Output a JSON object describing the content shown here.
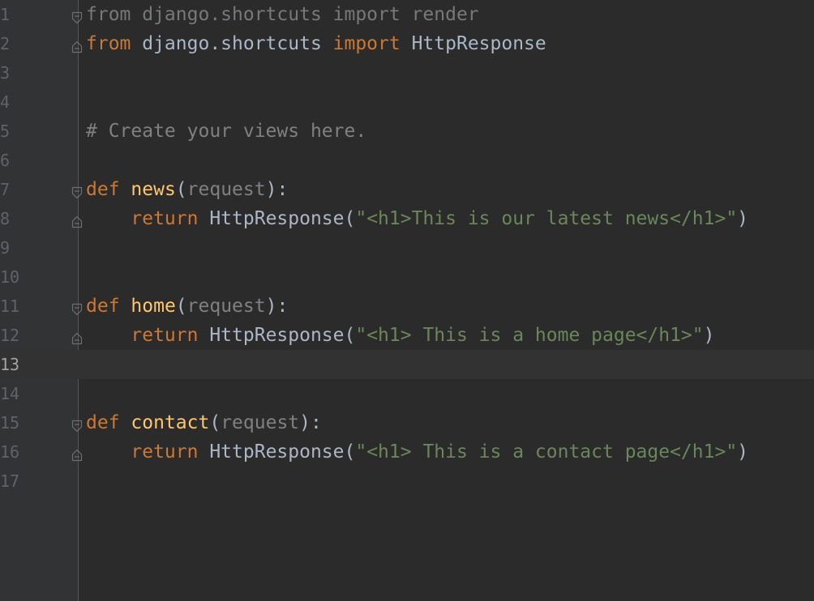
{
  "editor": {
    "theme": {
      "background": "#2b2b2b",
      "gutter": "#313335",
      "keyword": "#cc7832",
      "function": "#ffc66d",
      "string": "#6a8759",
      "identifier": "#a9b7c6",
      "comment": "#808080"
    },
    "current_line": 13,
    "lines": [
      {
        "n": "1",
        "fold": "open",
        "tokens": [
          {
            "t": "dim",
            "v": "from django.shortcuts import render"
          }
        ]
      },
      {
        "n": "2",
        "fold": "close",
        "tokens": [
          {
            "t": "kw",
            "v": "from"
          },
          {
            "t": "txt",
            "v": " django.shortcuts "
          },
          {
            "t": "kw",
            "v": "import"
          },
          {
            "t": "txt",
            "v": " HttpResponse"
          }
        ]
      },
      {
        "n": "3",
        "fold": "",
        "tokens": []
      },
      {
        "n": "4",
        "fold": "",
        "tokens": []
      },
      {
        "n": "5",
        "fold": "",
        "tokens": [
          {
            "t": "cmt",
            "v": "# Create your views here."
          }
        ]
      },
      {
        "n": "6",
        "fold": "",
        "tokens": []
      },
      {
        "n": "7",
        "fold": "open",
        "tokens": [
          {
            "t": "kw",
            "v": "def"
          },
          {
            "t": "txt",
            "v": " "
          },
          {
            "t": "fn",
            "v": "news"
          },
          {
            "t": "txt",
            "v": "("
          },
          {
            "t": "param",
            "v": "request"
          },
          {
            "t": "txt",
            "v": "):"
          }
        ]
      },
      {
        "n": "8",
        "fold": "close",
        "tokens": [
          {
            "t": "txt",
            "v": "    "
          },
          {
            "t": "kw",
            "v": "return"
          },
          {
            "t": "txt",
            "v": " HttpResponse("
          },
          {
            "t": "str",
            "v": "\"<h1>This is our latest news</h1>\""
          },
          {
            "t": "txt",
            "v": ")"
          }
        ]
      },
      {
        "n": "9",
        "fold": "",
        "tokens": []
      },
      {
        "n": "10",
        "fold": "",
        "tokens": []
      },
      {
        "n": "11",
        "fold": "open",
        "tokens": [
          {
            "t": "kw",
            "v": "def"
          },
          {
            "t": "txt",
            "v": " "
          },
          {
            "t": "fn",
            "v": "home"
          },
          {
            "t": "txt",
            "v": "("
          },
          {
            "t": "param",
            "v": "request"
          },
          {
            "t": "txt",
            "v": "):"
          }
        ]
      },
      {
        "n": "12",
        "fold": "close",
        "tokens": [
          {
            "t": "txt",
            "v": "    "
          },
          {
            "t": "kw",
            "v": "return"
          },
          {
            "t": "txt",
            "v": " HttpResponse("
          },
          {
            "t": "str",
            "v": "\"<h1> This is a home page</h1>\""
          },
          {
            "t": "txt",
            "v": ")"
          }
        ]
      },
      {
        "n": "13",
        "fold": "",
        "tokens": []
      },
      {
        "n": "14",
        "fold": "",
        "tokens": []
      },
      {
        "n": "15",
        "fold": "open",
        "tokens": [
          {
            "t": "kw",
            "v": "def"
          },
          {
            "t": "txt",
            "v": " "
          },
          {
            "t": "fn",
            "v": "contact"
          },
          {
            "t": "txt",
            "v": "("
          },
          {
            "t": "param",
            "v": "request"
          },
          {
            "t": "txt",
            "v": "):"
          }
        ]
      },
      {
        "n": "16",
        "fold": "close",
        "tokens": [
          {
            "t": "txt",
            "v": "    "
          },
          {
            "t": "kw",
            "v": "return"
          },
          {
            "t": "txt",
            "v": " HttpResponse("
          },
          {
            "t": "str",
            "v": "\"<h1> This is a contact page</h1>\""
          },
          {
            "t": "txt",
            "v": ")"
          }
        ]
      },
      {
        "n": "17",
        "fold": "",
        "tokens": []
      }
    ]
  }
}
